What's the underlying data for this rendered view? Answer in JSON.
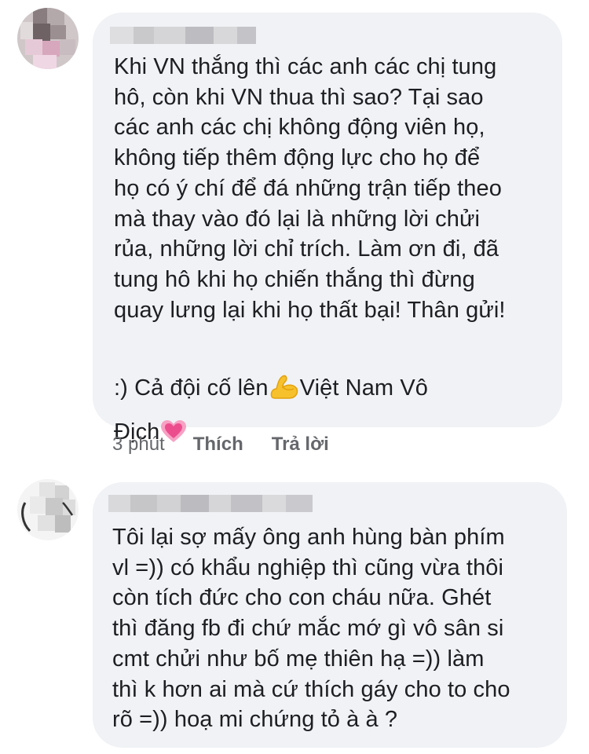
{
  "comments": [
    {
      "text": "Khi VN thắng thì các anh các chị tung\nhô, còn khi VN thua thì sao? Tại sao\ncác anh các chị không động viên họ,\nkhông tiếp thêm động lực cho họ để\nhọ có ý chí để đá những trận tiếp theo\nmà thay vào đó lại là những lời chửi\nrủa, những lời chỉ trích. Làm ơn đi, đã\ntung hô khi họ chiến thắng thì đừng\nquay lưng lại khi họ thất bại! Thân gửi!",
      "extra_line_1_a": ":) Cả đội cố lên",
      "extra_line_1_b": "Việt Nam Vô",
      "extra_line_2": "Địch",
      "emoji_1": "flexed-biceps-icon",
      "emoji_2": "growing-heart-icon",
      "time": "3 phút",
      "like_label": "Thích",
      "reply_label": "Trả lời"
    },
    {
      "text": "Tôi lại sợ mấy ông anh hùng bàn phím\nvl =)) có khẩu nghiệp thì cũng vừa thôi\ncòn tích đức cho con cháu nữa. Ghét\nthì đăng fb đi chứ mắc mớ gì vô sân si\ncmt chửi như bố mẹ thiên hạ =)) làm\nthì k hơn ai mà cứ thích gáy cho to cho\nrõ =)) hoạ mi chứng tỏ à à ?"
    }
  ],
  "colors": {
    "bubble": "#f0f2f5",
    "text": "#1c1e21",
    "meta": "#65676b"
  }
}
